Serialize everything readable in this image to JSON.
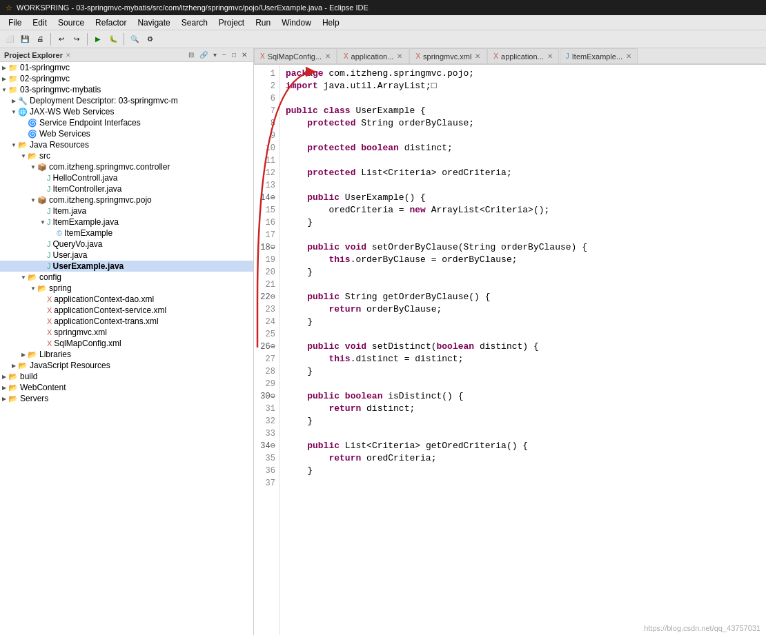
{
  "titlebar": {
    "icon": "☆",
    "text": "WORKSPRING - 03-springmvc-mybatis/src/com/itzheng/springmvc/pojo/UserExample.java - Eclipse IDE"
  },
  "menubar": {
    "items": [
      "File",
      "Edit",
      "Source",
      "Refactor",
      "Navigate",
      "Search",
      "Project",
      "Run",
      "Window",
      "Help"
    ]
  },
  "explorer": {
    "title": "Project Explorer",
    "close_icon": "✕",
    "items": [
      {
        "id": "01-springmvc",
        "label": "01-springmvc",
        "indent": 0,
        "arrow": "▶",
        "icon": "project"
      },
      {
        "id": "02-springmvc",
        "label": "02-springmvc",
        "indent": 0,
        "arrow": "▶",
        "icon": "project"
      },
      {
        "id": "03-springmvc-mybatis",
        "label": "03-springmvc-mybatis",
        "indent": 0,
        "arrow": "▼",
        "icon": "project"
      },
      {
        "id": "deployment-descriptor",
        "label": "Deployment Descriptor: 03-springmvc-m",
        "indent": 1,
        "arrow": "▶",
        "icon": "deployment"
      },
      {
        "id": "jax-ws",
        "label": "JAX-WS Web Services",
        "indent": 1,
        "arrow": "▼",
        "icon": "ws"
      },
      {
        "id": "service-endpoint",
        "label": "Service Endpoint Interfaces",
        "indent": 2,
        "arrow": "",
        "icon": "ws-item"
      },
      {
        "id": "web-services",
        "label": "Web Services",
        "indent": 2,
        "arrow": "",
        "icon": "ws-item"
      },
      {
        "id": "java-resources",
        "label": "Java Resources",
        "indent": 1,
        "arrow": "▼",
        "icon": "folder"
      },
      {
        "id": "src",
        "label": "src",
        "indent": 2,
        "arrow": "▼",
        "icon": "folder"
      },
      {
        "id": "pkg-controller",
        "label": "com.itzheng.springmvc.controller",
        "indent": 3,
        "arrow": "▼",
        "icon": "package"
      },
      {
        "id": "HelloControll",
        "label": "HelloControll.java",
        "indent": 4,
        "arrow": "",
        "icon": "java"
      },
      {
        "id": "ItemController",
        "label": "ItemController.java",
        "indent": 4,
        "arrow": "",
        "icon": "java"
      },
      {
        "id": "pkg-pojo",
        "label": "com.itzheng.springmvc.pojo",
        "indent": 3,
        "arrow": "▼",
        "icon": "package"
      },
      {
        "id": "Item",
        "label": "Item.java",
        "indent": 4,
        "arrow": "",
        "icon": "java"
      },
      {
        "id": "ItemExample",
        "label": "ItemExample.java",
        "indent": 4,
        "arrow": "▼",
        "icon": "java"
      },
      {
        "id": "ItemExample-class",
        "label": "ItemExample",
        "indent": 5,
        "arrow": "",
        "icon": "class"
      },
      {
        "id": "QueryVo",
        "label": "QueryVo.java",
        "indent": 4,
        "arrow": "",
        "icon": "java"
      },
      {
        "id": "User",
        "label": "User.java",
        "indent": 4,
        "arrow": "",
        "icon": "java"
      },
      {
        "id": "UserExample",
        "label": "UserExample.java",
        "indent": 4,
        "arrow": "",
        "icon": "java",
        "selected": true
      },
      {
        "id": "config",
        "label": "config",
        "indent": 2,
        "arrow": "▼",
        "icon": "folder"
      },
      {
        "id": "spring",
        "label": "spring",
        "indent": 3,
        "arrow": "▼",
        "icon": "folder"
      },
      {
        "id": "appCtx-dao",
        "label": "applicationContext-dao.xml",
        "indent": 4,
        "arrow": "",
        "icon": "xml"
      },
      {
        "id": "appCtx-service",
        "label": "applicationContext-service.xml",
        "indent": 4,
        "arrow": "",
        "icon": "xml"
      },
      {
        "id": "appCtx-trans",
        "label": "applicationContext-trans.xml",
        "indent": 4,
        "arrow": "",
        "icon": "xml"
      },
      {
        "id": "springmvc-xml",
        "label": "springmvc.xml",
        "indent": 4,
        "arrow": "",
        "icon": "xml"
      },
      {
        "id": "SqlMapConfig",
        "label": "SqlMapConfig.xml",
        "indent": 4,
        "arrow": "",
        "icon": "xml"
      },
      {
        "id": "Libraries",
        "label": "Libraries",
        "indent": 2,
        "arrow": "▶",
        "icon": "folder"
      },
      {
        "id": "JavaScriptResources",
        "label": "JavaScript Resources",
        "indent": 1,
        "arrow": "▶",
        "icon": "folder"
      },
      {
        "id": "build",
        "label": "build",
        "indent": 0,
        "arrow": "▶",
        "icon": "folder"
      },
      {
        "id": "WebContent",
        "label": "WebContent",
        "indent": 0,
        "arrow": "▶",
        "icon": "folder"
      },
      {
        "id": "Servers",
        "label": "Servers",
        "indent": 0,
        "arrow": "▶",
        "icon": "folder"
      }
    ]
  },
  "tabs": [
    {
      "id": "SqlMapConfig",
      "label": "SqlMapConfig...",
      "icon": "xml",
      "active": false
    },
    {
      "id": "application1",
      "label": "application...",
      "icon": "xml",
      "active": false
    },
    {
      "id": "springmvc-xml",
      "label": "springmvc.xml",
      "icon": "xml",
      "active": false
    },
    {
      "id": "application2",
      "label": "application...",
      "icon": "xml",
      "active": false
    },
    {
      "id": "ItemExample",
      "label": "ItemExample...",
      "icon": "java",
      "active": false
    }
  ],
  "code": {
    "filename": "UserExample.java",
    "lines": [
      {
        "num": "1",
        "content": "package com.itzheng.springmvc.pojo;",
        "highlighted": false
      },
      {
        "num": "2",
        "content": "import java.util.ArrayList;□",
        "highlighted": false
      },
      {
        "num": "6",
        "content": "",
        "highlighted": false
      },
      {
        "num": "7",
        "content": "public class UserExample {",
        "highlighted": false
      },
      {
        "num": "8",
        "content": "    protected String orderByClause;",
        "highlighted": false
      },
      {
        "num": "9",
        "content": "",
        "highlighted": false
      },
      {
        "num": "10",
        "content": "    protected boolean distinct;",
        "highlighted": false
      },
      {
        "num": "11",
        "content": "",
        "highlighted": false
      },
      {
        "num": "12",
        "content": "    protected List<Criteria> oredCriteria;",
        "highlighted": false
      },
      {
        "num": "13",
        "content": "",
        "highlighted": false
      },
      {
        "num": "14",
        "content": "    public UserExample() {",
        "highlighted": false
      },
      {
        "num": "15",
        "content": "        oredCriteria = new ArrayList<Criteria>();",
        "highlighted": false
      },
      {
        "num": "16",
        "content": "    }",
        "highlighted": false
      },
      {
        "num": "17",
        "content": "",
        "highlighted": false
      },
      {
        "num": "18",
        "content": "    public void setOrderByClause(String orderByClause) {",
        "highlighted": false
      },
      {
        "num": "19",
        "content": "        this.orderByClause = orderByClause;",
        "highlighted": false
      },
      {
        "num": "20",
        "content": "    }",
        "highlighted": false
      },
      {
        "num": "21",
        "content": "",
        "highlighted": false
      },
      {
        "num": "22",
        "content": "    public String getOrderByClause() {",
        "highlighted": false
      },
      {
        "num": "23",
        "content": "        return orderByClause;",
        "highlighted": false
      },
      {
        "num": "24",
        "content": "    }",
        "highlighted": false
      },
      {
        "num": "25",
        "content": "",
        "highlighted": false
      },
      {
        "num": "26",
        "content": "    public void setDistinct(boolean distinct) {",
        "highlighted": false
      },
      {
        "num": "27",
        "content": "        this.distinct = distinct;",
        "highlighted": false
      },
      {
        "num": "28",
        "content": "    }",
        "highlighted": false
      },
      {
        "num": "29",
        "content": "",
        "highlighted": false
      },
      {
        "num": "30",
        "content": "    public boolean isDistinct() {",
        "highlighted": false
      },
      {
        "num": "31",
        "content": "        return distinct;",
        "highlighted": false
      },
      {
        "num": "32",
        "content": "    }",
        "highlighted": false
      },
      {
        "num": "33",
        "content": "",
        "highlighted": false
      },
      {
        "num": "34",
        "content": "    public List<Criteria> getOredCriteria() {",
        "highlighted": false
      },
      {
        "num": "35",
        "content": "        return oredCriteria;",
        "highlighted": false
      },
      {
        "num": "36",
        "content": "    }",
        "highlighted": false
      },
      {
        "num": "37",
        "content": "",
        "highlighted": false
      }
    ]
  },
  "watermark": "https://blog.csdn.net/qq_43757031"
}
